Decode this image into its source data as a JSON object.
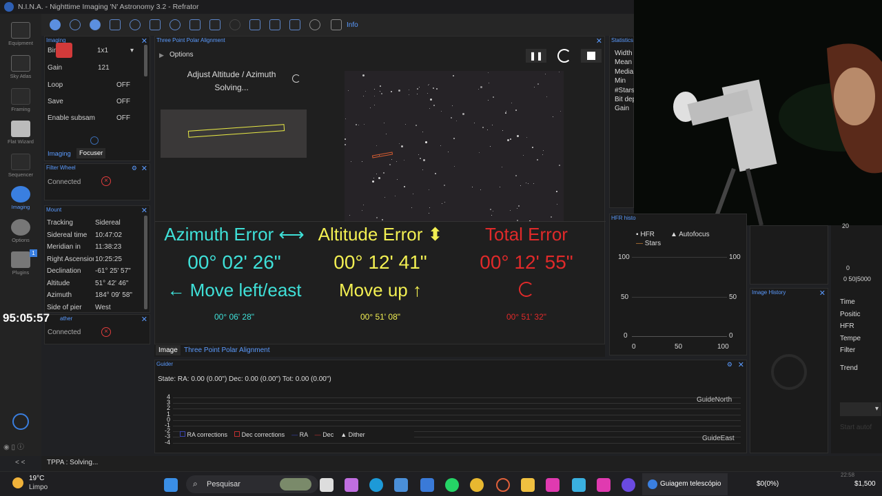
{
  "app": {
    "title": "N.I.N.A. - Nighttime Imaging 'N' Astronomy 3.2  -  Refrator"
  },
  "sidebar": {
    "items": [
      {
        "label": "Equipment"
      },
      {
        "label": "Sky Atlas"
      },
      {
        "label": "Framing"
      },
      {
        "label": "Flat Wizard"
      },
      {
        "label": "Sequencer"
      },
      {
        "label": "Imaging"
      },
      {
        "label": "Options"
      },
      {
        "label": "Plugins"
      }
    ],
    "plugins_badge": "1",
    "collapse": "< <"
  },
  "tabbar": {
    "info_label": "Info"
  },
  "imaging_panel": {
    "title": "Imaging",
    "binning_label": "Bin",
    "binning_value": "1x1",
    "gain_label": "Gain",
    "gain_value": "121",
    "loop_label": "Loop",
    "loop_value": "OFF",
    "save_label": "Save",
    "save_value": "OFF",
    "subsample_label": "Enable subsam",
    "subsample_value": "OFF",
    "tab_imaging": "Imaging",
    "tab_focuser": "Focuser"
  },
  "filter_wheel": {
    "title": "Filter Wheel",
    "status": "Connected"
  },
  "mount": {
    "title": "Mount",
    "rows": [
      {
        "label": "Tracking",
        "value": "Sidereal"
      },
      {
        "label": "Sidereal time",
        "value": "10:47:02"
      },
      {
        "label": "Meridian in",
        "value": "11:38:23"
      },
      {
        "label": "Right Ascension",
        "value": "10:25:25"
      },
      {
        "label": "Declination",
        "value": "-61° 25' 57\""
      },
      {
        "label": "Altitude",
        "value": "51° 42' 46\""
      },
      {
        "label": "Azimuth",
        "value": "184° 09' 58\""
      },
      {
        "label": "Side of pier",
        "value": "West"
      }
    ]
  },
  "weather": {
    "title": "ather",
    "status": "Connected"
  },
  "overlay_timer": "95:05:57",
  "tppa": {
    "title": "Three Point Polar Alignment",
    "options_label": "Options",
    "adjust_label": "Adjust Altitude / Azimuth",
    "solving_label": "Solving...",
    "azimuth": {
      "title": "Azimuth Error ⟷",
      "value": "00° 02' 26\"",
      "hint": "← Move left/east",
      "total": "00° 06' 28\""
    },
    "altitude": {
      "title": "Altitude Error ⬍",
      "value": "00° 12' 41\"",
      "hint": "Move up ↑",
      "total": "00° 51' 08\""
    },
    "total": {
      "title": "Total Error",
      "value": "00° 12' 55\"",
      "total": "00° 51' 32\""
    },
    "tab_image": "Image",
    "tab_tppa": "Three Point Polar Alignment"
  },
  "statistics": {
    "title": "Statistics",
    "labels": [
      "Width",
      "Mean",
      "Media",
      "Min",
      "#Stars",
      "Bit dep",
      "Gain"
    ]
  },
  "hfr_history": {
    "title": "HFR histo",
    "legend_hfr": "HFR",
    "legend_autofocus": "Autofocus",
    "legend_stars": "Stars",
    "y_ticks": [
      "100",
      "50",
      "0"
    ],
    "x_ticks": [
      "0",
      "50",
      "100"
    ],
    "y_ticks_right": [
      "100",
      "50",
      "0"
    ]
  },
  "image_history": {
    "title": "Image History"
  },
  "right_column": {
    "top_tick": "20",
    "zero": "0",
    "axis": "0 50|5000",
    "labels": [
      "Time",
      "Positic",
      "HFR",
      "Tempe",
      "Filter",
      "Trend"
    ],
    "start_button": "Start autof"
  },
  "guider": {
    "title": "Guider",
    "state": "State:  RA: 0.00 (0.00\")  Dec: 0.00 (0.00\")  Tot: 0.00 (0.00\")",
    "y_ticks": [
      "4",
      "3",
      "2",
      "1",
      "0",
      "-1",
      "-2",
      "-3",
      "-4"
    ],
    "north": "GuideNorth",
    "east": "GuideEast",
    "legend": [
      "RA corrections",
      "Dec corrections",
      "RA",
      "Dec",
      "Dither"
    ]
  },
  "status_bar": {
    "text": "TPPA :  Solving..."
  },
  "taskbar": {
    "weather_temp": "19°C",
    "weather_desc": "Limpo",
    "search": "Pesquisar",
    "stream_title": "Guiagem telescópio",
    "amount1": "$0(0%)",
    "amount2": "$1,500",
    "time_partial": "22:58"
  },
  "colors": {
    "accent": "#5b9bff",
    "cyan": "#3fe0d8",
    "yellow": "#f2ef52",
    "red": "#e02a2a"
  }
}
